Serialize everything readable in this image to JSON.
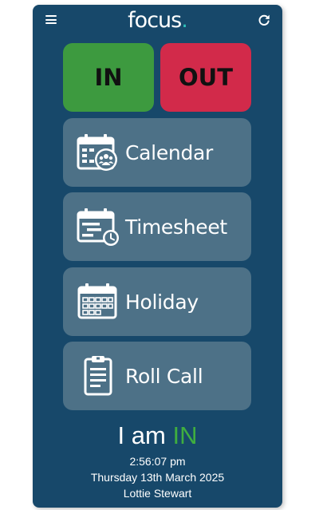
{
  "header": {
    "logo_text": "focus",
    "logo_dot": ".",
    "menu_icon": "hamburger-menu-icon",
    "refresh_icon": "refresh-icon"
  },
  "clock_buttons": {
    "in_label": "IN",
    "out_label": "OUT"
  },
  "menu": [
    {
      "label": "Calendar",
      "icon": "calendar-people-icon"
    },
    {
      "label": "Timesheet",
      "icon": "calendar-clock-icon"
    },
    {
      "label": "Holiday",
      "icon": "calendar-grid-icon"
    },
    {
      "label": "Roll Call",
      "icon": "clipboard-list-icon"
    }
  ],
  "status": {
    "prefix": "I am",
    "state": "IN",
    "time": "2:56:07 pm",
    "date": "Thursday 13th March 2025",
    "user": "Lottie Stewart"
  },
  "colors": {
    "background": "#17486a",
    "tile": "#4d7187",
    "in_button": "#3d9a3f",
    "out_button": "#d22a4a",
    "status_in": "#3fae3f",
    "logo_accent": "#2fc1ba"
  }
}
